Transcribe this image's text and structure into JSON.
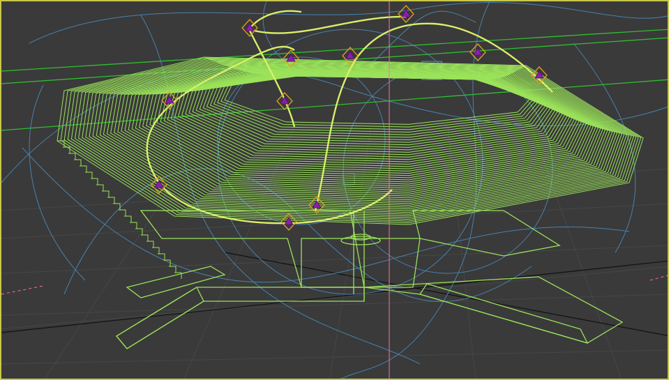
{
  "viewport": {
    "type": "perspective-3d-viewport",
    "mode": "wireframe",
    "colors": {
      "background": "#3a3a3a",
      "border_active": "#c8c84a",
      "grid": "#4a4a4a",
      "horizon_lines": "#2fbf2f",
      "mesh_wireframe": "#9be35a",
      "spline_highlight": "#d9ef6a",
      "helper_curves": "#4a8fc0",
      "control_point_fill": "#8b1fa8",
      "control_point_outline": "#e0a020",
      "axis_vertical": "#ff6fa8"
    },
    "control_points": 11
  }
}
